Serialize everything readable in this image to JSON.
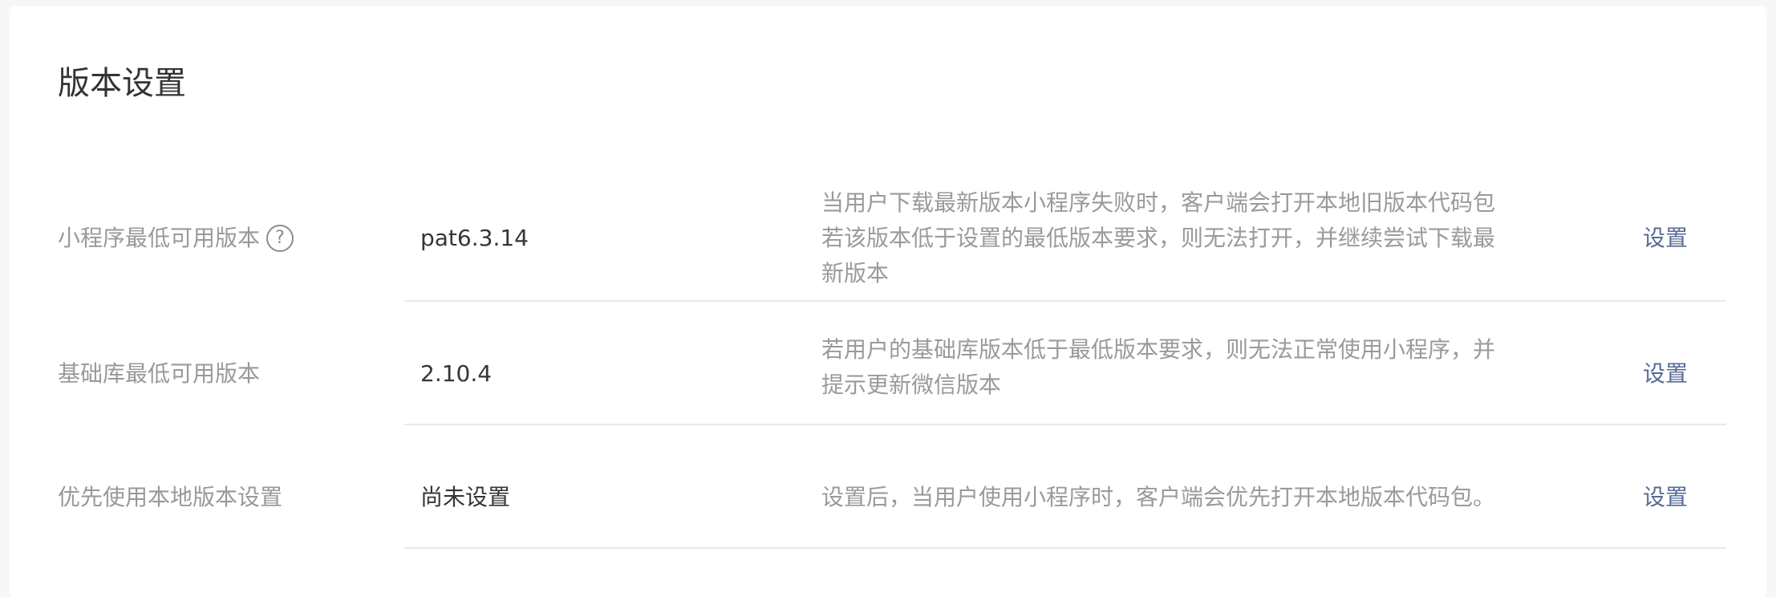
{
  "page": {
    "title": "版本设置"
  },
  "rows": [
    {
      "label": "小程序最低可用版本",
      "help_icon": "question-circle-icon",
      "help_symbol": "?",
      "value": "pat6.3.14",
      "description_lines": [
        "当用户下载最新版本小程序失败时，客户端会打开本地旧版本代码包",
        "若该版本低于设置的最低版本要求，则无法打开，并继续尝试下载最",
        "新版本"
      ],
      "action_label": "设置"
    },
    {
      "label": "基础库最低可用版本",
      "value": "2.10.4",
      "description_lines": [
        "若用户的基础库版本低于最低版本要求，则无法正常使用小程序，并",
        "提示更新微信版本"
      ],
      "action_label": "设置"
    },
    {
      "label": "优先使用本地版本设置",
      "value": "尚未设置",
      "description_lines": [
        "设置后，当用户使用小程序时，客户端会优先打开本地版本代码包。"
      ],
      "action_label": "设置"
    }
  ],
  "colors": {
    "background": "#f6f7f9",
    "panel": "#ffffff",
    "title": "#333333",
    "label": "#999999",
    "value": "#353535",
    "description": "#9a9a9a",
    "link": "#576b95",
    "divider": "#e9e9e9"
  }
}
